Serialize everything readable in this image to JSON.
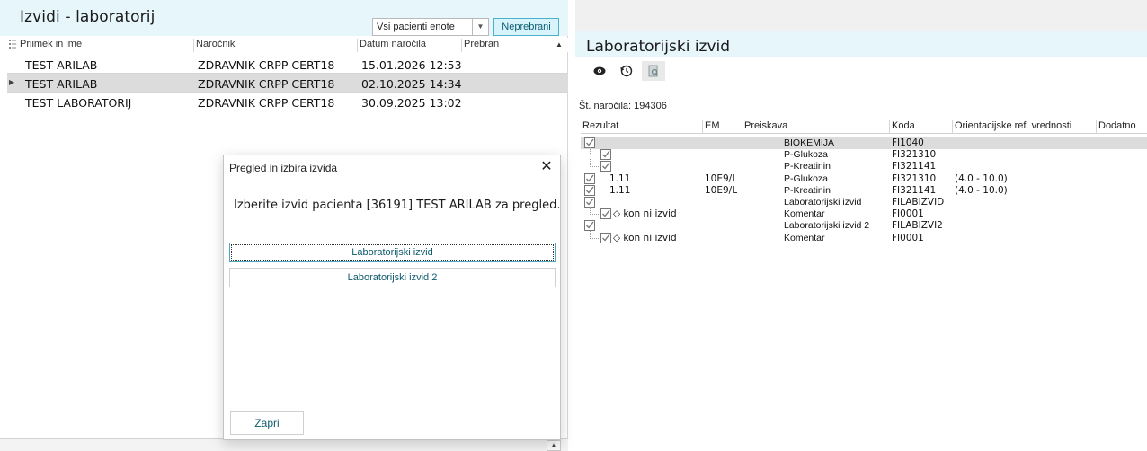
{
  "left": {
    "title": "Izvidi - laboratorij",
    "filter_value": "Vsi pacienti enote",
    "filter_button": "Neprebrani",
    "columns": [
      "Priimek in ime",
      "Naročnik",
      "Datum naročila",
      "Prebran"
    ],
    "rows": [
      {
        "name": "TEST ARILAB",
        "orderer": "ZDRAVNIK CRPP CERT18",
        "date": "15.01.2026 12:53",
        "read": ""
      },
      {
        "name": "TEST ARILAB",
        "orderer": "ZDRAVNIK CRPP CERT18",
        "date": "02.10.2025 14:34",
        "read": ""
      },
      {
        "name": "TEST LABORATORIJ",
        "orderer": "ZDRAVNIK CRPP CERT18",
        "date": "30.09.2025 13:02",
        "read": ""
      }
    ]
  },
  "dialog": {
    "title": "Pregled in izbira izvida",
    "close": "✕",
    "message": "Izberite izvid pacienta [36191] TEST ARILAB za pregled.",
    "options": [
      "Laboratorijski izvid",
      "Laboratorijski izvid 2"
    ],
    "close_button": "Zapri"
  },
  "right": {
    "title": "Laboratorijski izvid",
    "order_label": "Št. naročila: 194306",
    "columns": [
      "Rezultat",
      "EM",
      "Preiskava",
      "Koda",
      "Orientacijske ref. vrednosti",
      "Dodatno"
    ],
    "rows": [
      {
        "level": 0,
        "result": "",
        "unit": "",
        "test": "BIOKEMIJA",
        "code": "FI1040",
        "ref": "",
        "group": true
      },
      {
        "level": 1,
        "result": "",
        "unit": "",
        "test": "P-Glukoza",
        "code": "FI321310",
        "ref": ""
      },
      {
        "level": 1,
        "result": "",
        "unit": "",
        "test": "P-Kreatinin",
        "code": "FI321141",
        "ref": ""
      },
      {
        "level": 0,
        "result": "1.11",
        "unit": "10E9/L",
        "test": "P-Glukoza",
        "code": "FI321310",
        "ref": "(4.0 - 10.0)"
      },
      {
        "level": 0,
        "result": "1.11",
        "unit": "10E9/L",
        "test": "P-Kreatinin",
        "code": "FI321141",
        "ref": "(4.0 - 10.0)"
      },
      {
        "level": 0,
        "result": "",
        "unit": "",
        "test": "Laboratorijski izvid",
        "code": "FILABIZVID",
        "ref": ""
      },
      {
        "level": 1,
        "result": "◇ kon ni izvid",
        "unit": "",
        "test": "Komentar",
        "code": "FI0001",
        "ref": ""
      },
      {
        "level": 0,
        "result": "",
        "unit": "",
        "test": "Laboratorijski izvid 2",
        "code": "FILABIZVI2",
        "ref": ""
      },
      {
        "level": 1,
        "result": "◇ kon ni izvid",
        "unit": "",
        "test": "Komentar",
        "code": "FI0001",
        "ref": ""
      }
    ]
  },
  "icons": {
    "toolbar": [
      "eye-icon",
      "history-icon",
      "document-view-icon"
    ],
    "row_check": "checkbox-checked-icon"
  },
  "colors": {
    "header_bg": "#e6f6fb",
    "accent": "#4bb3c9",
    "selected_row": "#dcdcdc"
  }
}
